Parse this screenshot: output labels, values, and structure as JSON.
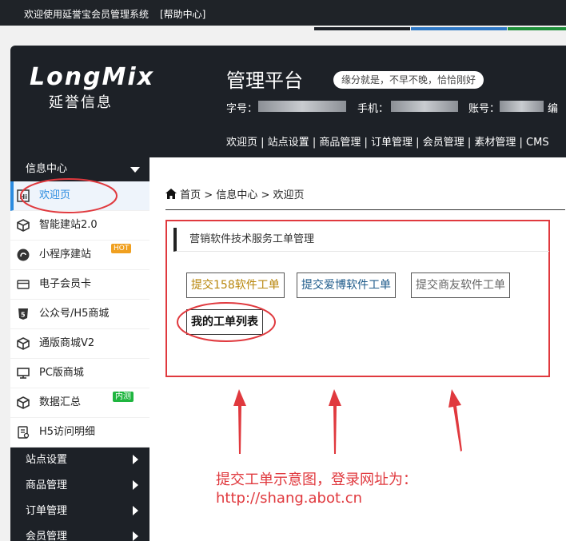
{
  "topbar": {
    "welcome": "欢迎使用延誉宝会员管理系统",
    "help": "[帮助中心]"
  },
  "colors": {
    "dark": "#1d2127",
    "accent": "#2a8be0",
    "annotation": "#e0393e",
    "stripe": [
      "#1d2127",
      "#2f78c5",
      "#1f8f3a"
    ]
  },
  "header": {
    "logo": "LongMix",
    "logo_sub": "延誉信息",
    "platform": "管理平台",
    "motto": "缘分就是，不早不晚，恰恰刚好",
    "labels": {
      "zihao": "字号：",
      "phone": "手机：",
      "account": "账号：",
      "edit": "编"
    }
  },
  "topnav": [
    "欢迎页",
    "站点设置",
    "商品管理",
    "订单管理",
    "会员管理",
    "素材管理",
    "CMS"
  ],
  "sidebar": {
    "section": "信息中心",
    "items": [
      {
        "label": "欢迎页",
        "icon": "hi-icon"
      },
      {
        "label": "智能建站2.0",
        "icon": "cube-icon"
      },
      {
        "label": "小程序建站",
        "icon": "mini-program-icon",
        "badge": "HOT"
      },
      {
        "label": "电子会员卡",
        "icon": "card-icon"
      },
      {
        "label": "公众号/H5商城",
        "icon": "html5-icon"
      },
      {
        "label": "通版商城V2",
        "icon": "cube-icon"
      },
      {
        "label": "PC版商城",
        "icon": "monitor-icon"
      },
      {
        "label": "数据汇总",
        "icon": "cube-icon",
        "badge": "内测"
      },
      {
        "label": "H5访问明细",
        "icon": "document-icon"
      }
    ],
    "sections": [
      "站点设置",
      "商品管理",
      "订单管理",
      "会员管理"
    ]
  },
  "breadcrumb": {
    "home": "首页",
    "sep": ">",
    "center": "信息中心",
    "current": "欢迎页"
  },
  "ticket": {
    "title": "营销软件技术服务工单管理",
    "buttons": [
      "提交158软件工单",
      "提交爱博软件工单",
      "提交商友软件工单",
      "我的工单列表"
    ],
    "button_colors": [
      "#b8860b",
      "#1d5a8a",
      "#666666",
      "#111111"
    ]
  },
  "annotation": {
    "line1": "提交工单示意图，登录网址为：",
    "line2": "http://shang.abot.cn"
  }
}
